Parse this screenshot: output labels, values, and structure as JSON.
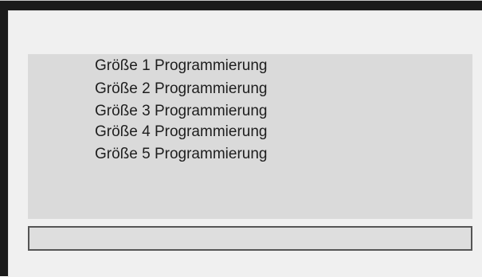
{
  "menu": {
    "items": [
      {
        "label": "Größe 1 Programmierung"
      },
      {
        "label": "Größe 2 Programmierung"
      },
      {
        "label": "Größe 3 Programmierung"
      },
      {
        "label": "Größe 4 Programmierung"
      },
      {
        "label": "Größe 5 Programmierung"
      }
    ]
  },
  "status": {
    "text": ""
  },
  "colors": {
    "frame": "#1a1a1a",
    "screen_background": "#f0f0f0",
    "list_background": "#dadada",
    "text": "#1e1e1e",
    "status_border": "#555555"
  }
}
